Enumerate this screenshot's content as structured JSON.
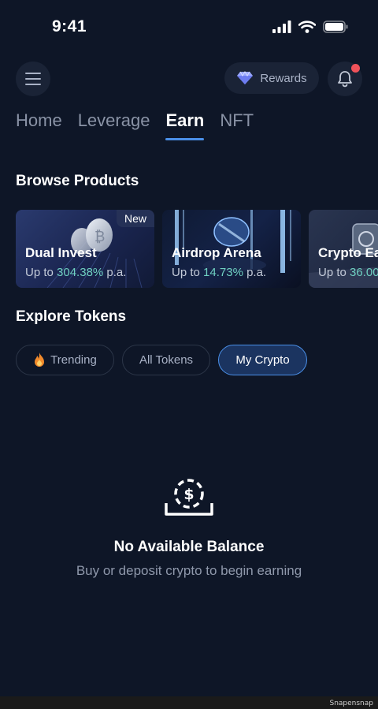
{
  "status_bar": {
    "time": "9:41"
  },
  "header": {
    "rewards_label": "Rewards"
  },
  "tabs": [
    {
      "label": "Home",
      "active": false
    },
    {
      "label": "Leverage",
      "active": false
    },
    {
      "label": "Earn",
      "active": true
    },
    {
      "label": "NFT",
      "active": false
    }
  ],
  "browse": {
    "title": "Browse Products",
    "products": [
      {
        "name": "Dual Invest",
        "rate_prefix": "Up to ",
        "rate": "304.38%",
        "rate_suffix": " p.a.",
        "badge": "New"
      },
      {
        "name": "Airdrop Arena",
        "rate_prefix": "Up to ",
        "rate": "14.73%",
        "rate_suffix": " p.a."
      },
      {
        "name": "Crypto Ea",
        "rate_prefix": "Up to ",
        "rate": "36.00",
        "rate_suffix": ""
      }
    ]
  },
  "explore": {
    "title": "Explore Tokens",
    "filters": [
      {
        "label": "Trending",
        "icon": "fire-icon",
        "active": false
      },
      {
        "label": "All Tokens",
        "active": false
      },
      {
        "label": "My Crypto",
        "active": true
      }
    ]
  },
  "empty_state": {
    "icon": "coin-deposit-icon",
    "title": "No Available Balance",
    "subtitle": "Buy or deposit crypto to begin earning"
  },
  "watermark": "Snapensnap",
  "colors": {
    "background": "#0e1627",
    "accent": "#4a8fe7",
    "rate_green": "#6fd0c1",
    "notification_dot": "#f0525a"
  }
}
